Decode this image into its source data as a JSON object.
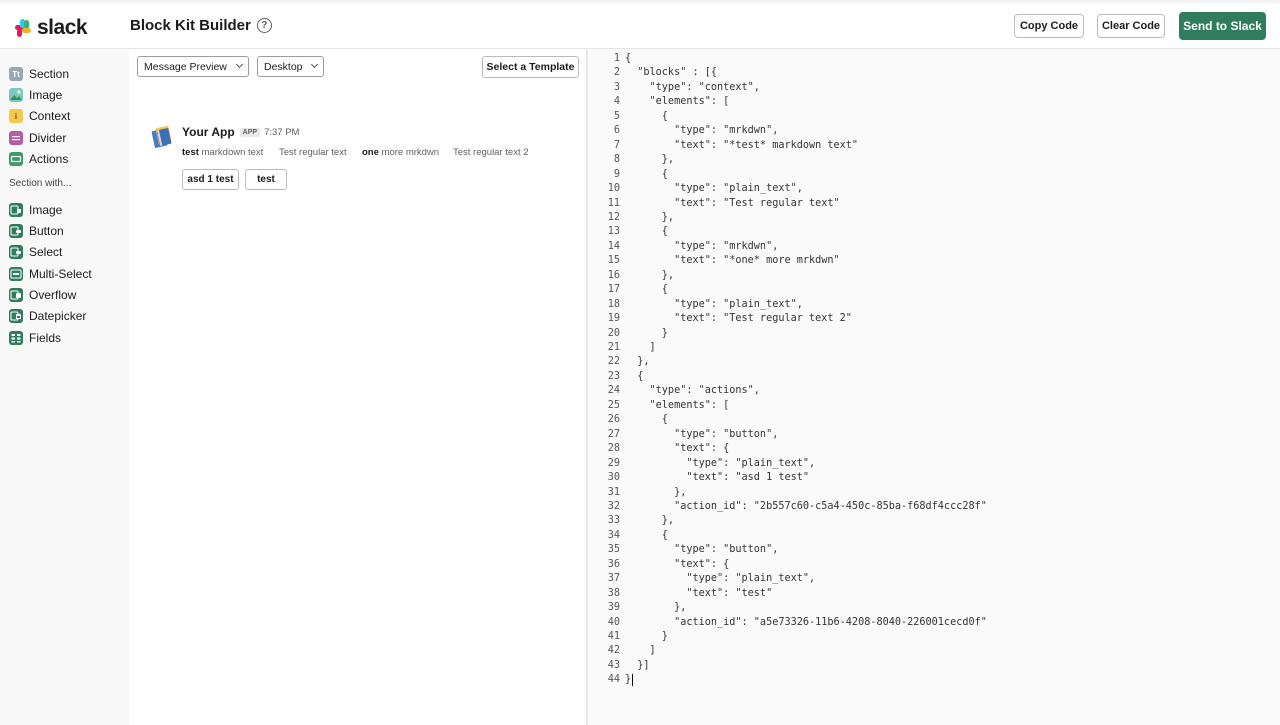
{
  "header": {
    "logo_text": "slack",
    "title": "Block Kit Builder",
    "help_icon": "question-circle-icon",
    "copy_code": "Copy Code",
    "clear_code": "Clear Code",
    "send_to_slack": "Send to Slack",
    "colors": {
      "send_button": "#2f7d5c"
    }
  },
  "sidebar": {
    "blocks": [
      {
        "label": "Section",
        "icon": "section-icon",
        "color": "#9aa6b2"
      },
      {
        "label": "Image",
        "icon": "image-icon",
        "color": "#7ec8c4"
      },
      {
        "label": "Context",
        "icon": "context-icon",
        "color": "#f2c94c"
      },
      {
        "label": "Divider",
        "icon": "divider-icon",
        "color": "#b25ea9"
      },
      {
        "label": "Actions",
        "icon": "actions-icon",
        "color": "#3c9a6e"
      }
    ],
    "section_with_heading": "Section with...",
    "section_with": [
      {
        "label": "Image",
        "icon": "image-accessory-icon",
        "color": "#2f7d5c"
      },
      {
        "label": "Button",
        "icon": "button-accessory-icon",
        "color": "#2f7d5c"
      },
      {
        "label": "Select",
        "icon": "select-accessory-icon",
        "color": "#2f7d5c"
      },
      {
        "label": "Multi-Select",
        "icon": "multi-select-accessory-icon",
        "color": "#2f7d5c"
      },
      {
        "label": "Overflow",
        "icon": "overflow-accessory-icon",
        "color": "#2f7d5c"
      },
      {
        "label": "Datepicker",
        "icon": "datepicker-accessory-icon",
        "color": "#2f7d5c"
      },
      {
        "label": "Fields",
        "icon": "fields-icon",
        "color": "#2f7d5c"
      }
    ]
  },
  "preview": {
    "mode_select": "Message Preview",
    "device_select": "Desktop",
    "template_button": "Select a Template",
    "message": {
      "app_name": "Your App",
      "badge": "APP",
      "time": "7:37 PM",
      "context": [
        {
          "bold": "test",
          "rest": " markdown text"
        },
        {
          "bold": "",
          "rest": "Test regular text"
        },
        {
          "bold": "one",
          "rest": " more mrkdwn"
        },
        {
          "bold": "",
          "rest": "Test regular text 2"
        }
      ],
      "buttons": [
        "asd 1 test",
        "test"
      ]
    }
  },
  "editor": {
    "lines": [
      "{",
      "  \"blocks\" : [{",
      "    \"type\": \"context\",",
      "    \"elements\": [",
      "      {",
      "        \"type\": \"mrkdwn\",",
      "        \"text\": \"*test* markdown text\"",
      "      },",
      "      {",
      "        \"type\": \"plain_text\",",
      "        \"text\": \"Test regular text\"",
      "      },",
      "      {",
      "        \"type\": \"mrkdwn\",",
      "        \"text\": \"*one* more mrkdwn\"",
      "      },",
      "      {",
      "        \"type\": \"plain_text\",",
      "        \"text\": \"Test regular text 2\"",
      "      }",
      "    ]",
      "  },",
      "  {",
      "    \"type\": \"actions\",",
      "    \"elements\": [",
      "      {",
      "        \"type\": \"button\",",
      "        \"text\": {",
      "          \"type\": \"plain_text\",",
      "          \"text\": \"asd 1 test\"",
      "        },",
      "        \"action_id\": \"2b557c60-c5a4-450c-85ba-f68df4ccc28f\"",
      "      },",
      "      {",
      "        \"type\": \"button\",",
      "        \"text\": {",
      "          \"type\": \"plain_text\",",
      "          \"text\": \"test\"",
      "        },",
      "        \"action_id\": \"a5e73326-11b6-4208-8040-226001cecd0f\"",
      "      }",
      "    ]",
      "  }]",
      "}"
    ]
  }
}
